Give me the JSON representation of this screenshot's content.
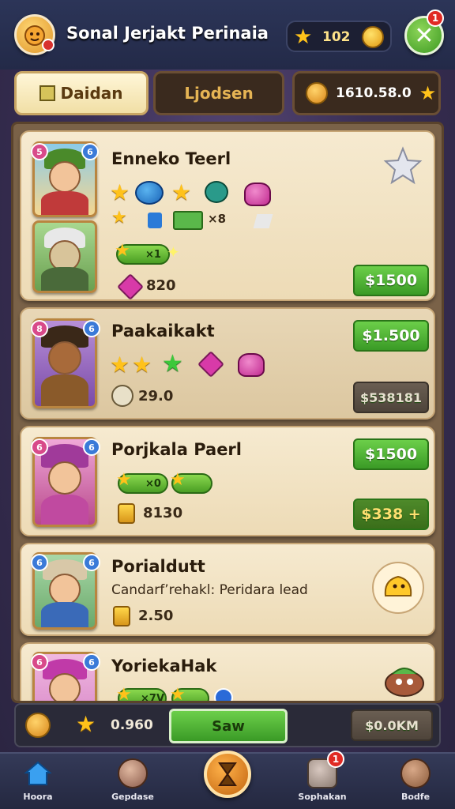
{
  "header": {
    "player_name": "Sonal Jerjakt Perinaia",
    "stars_value": "102",
    "close_label": "✕",
    "close_badge": "1"
  },
  "tabs": [
    {
      "label": "Daidan"
    },
    {
      "label": "Ljodsen"
    },
    {
      "label": "1610.58.0"
    }
  ],
  "cards": [
    {
      "title": "Enneko Teerl",
      "stat": "820",
      "price": "$1500",
      "icons_label": "×8"
    },
    {
      "title": "Paakaikakt",
      "stat": "29.0",
      "price": "$1.500",
      "price2": "$538181"
    },
    {
      "title": "Porjkala Paerl",
      "stat": "8130",
      "price": "$1500",
      "price2": "$338 +"
    },
    {
      "title": "Porialdutt",
      "subtitle": "Candarf’rehakl: Peridara lead",
      "stat": "2.50"
    },
    {
      "title": "YoriekaHak",
      "pill": "×7V"
    }
  ],
  "pills": {
    "c1": "×1",
    "c3": "×0"
  },
  "actionbar": {
    "value": "0.960",
    "save_label": "Saw",
    "amount": "$0.0KM"
  },
  "nav": [
    {
      "label": "Hoora",
      "icon": "home-icon"
    },
    {
      "label": "Gepdase",
      "icon": "menu-icon"
    },
    {
      "label": "",
      "icon": "hourglass-icon"
    },
    {
      "label": "Sophakan",
      "icon": "chest-icon",
      "badge": "1"
    },
    {
      "label": "Bodfe",
      "icon": "profile-icon"
    }
  ],
  "colors": {
    "accent_green": "#4cb02e",
    "gold": "#ffc21a",
    "card_bg": "#f2e3c3"
  }
}
